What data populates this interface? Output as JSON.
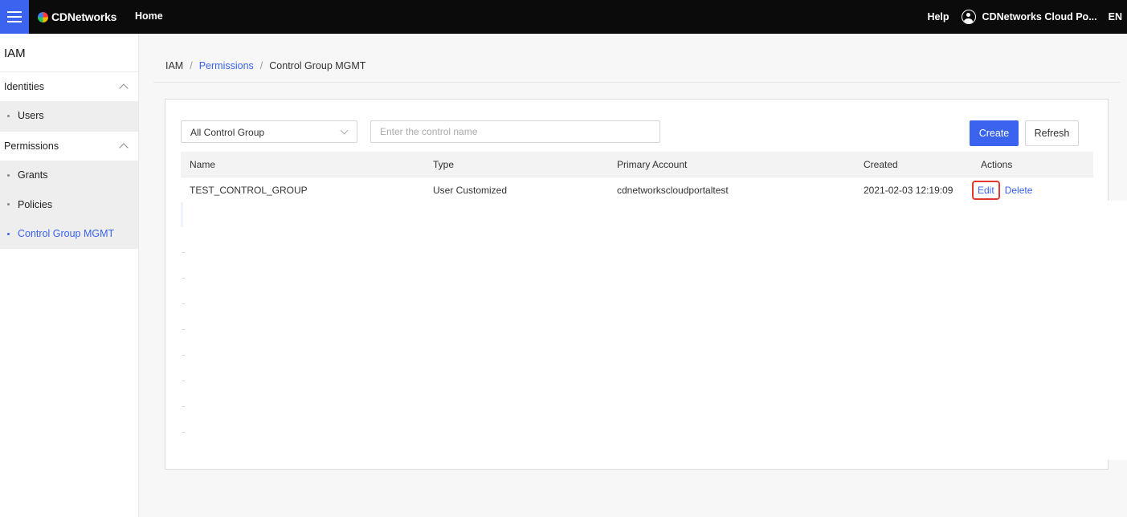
{
  "topbar": {
    "brand": "CDNetworks",
    "home": "Home",
    "help": "Help",
    "account": "CDNetworks Cloud Po...",
    "lang": "EN"
  },
  "sidebar": {
    "title": "IAM",
    "groups": [
      {
        "label": "Identities",
        "items": [
          "Users"
        ]
      },
      {
        "label": "Permissions",
        "items": [
          "Grants",
          "Policies",
          "Control Group MGMT"
        ]
      }
    ],
    "active_item": "Control Group MGMT"
  },
  "breadcrumb": {
    "root": "IAM",
    "parent": "Permissions",
    "current": "Control Group MGMT",
    "separator": "/"
  },
  "toolbar": {
    "filter_value": "All Control Group",
    "search_placeholder": "Enter the control name",
    "create_label": "Create",
    "refresh_label": "Refresh"
  },
  "table": {
    "columns": [
      "Name",
      "Type",
      "Primary Account",
      "Created",
      "Actions"
    ],
    "rows": [
      {
        "name": "TEST_CONTROL_GROUP",
        "type": "User Customized",
        "primary_account": "cdnetworkscloudportaltest",
        "created": "2021-02-03 12:19:09",
        "edit": "Edit",
        "delete": "Delete"
      }
    ]
  },
  "colors": {
    "accent": "#3a63f0",
    "topbar": "#0b0b0c",
    "highlight": "#e03a2e"
  }
}
